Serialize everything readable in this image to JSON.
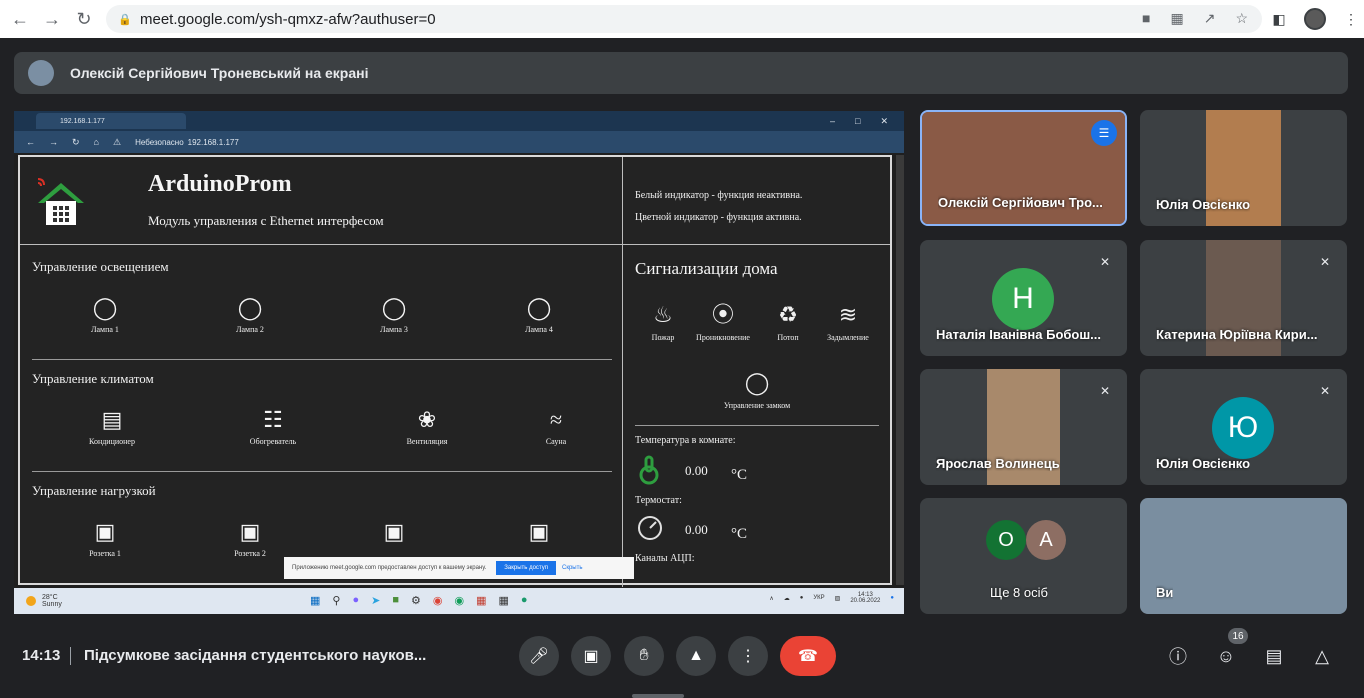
{
  "browser": {
    "url": "meet.google.com/ysh-qmxz-afw?authuser=0"
  },
  "banner": {
    "presenter_text": "Олексій Сергійович Троневський на екрані"
  },
  "shared": {
    "edge_tab_title": "192.168.1.177",
    "insecure_label": "Небезопасно",
    "address": "192.168.1.177",
    "brand": "ArduinoProm",
    "subtitle": "Модуль управления с Ethernet интерфесом",
    "legend_white": "Белый индикатор - функция неактивна.",
    "legend_color": "Цветной индикатор - функция активна.",
    "lighting_title": "Управление освещением",
    "lamps": [
      "Лампа 1",
      "Лампа 2",
      "Лампа 3",
      "Лампа 4"
    ],
    "climate_title": "Управление климатом",
    "climate": [
      "Кондиционер",
      "Обогреватель",
      "Вентиляция",
      "Сауна"
    ],
    "load_title": "Управление нагрузкой",
    "sockets": [
      "Розетка 1",
      "Розетка 2"
    ],
    "alarm_title": "Сигнализации дома",
    "alarms": [
      "Пожар",
      "Проникновение",
      "Потоп",
      "Задымление"
    ],
    "lock_label": "Управление замком",
    "temp_label": "Температура в комнате:",
    "temp_value": "0.00",
    "temp_unit": "°C",
    "thermostat_label": "Термостат:",
    "thermostat_value": "0.00",
    "thermostat_unit": "°C",
    "adc_label": "Каналы АЦП:",
    "share_note": "Приложению meet.google.com предоставлен доступ к вашему экрану.",
    "stop_sharing": "Закрыть доступ",
    "hide": "Скрыть",
    "weather_temp": "28°C",
    "weather_desc": "Sunny",
    "lang": "УКР",
    "tb_time": "14:13",
    "tb_date": "20.06.2022"
  },
  "participants": [
    {
      "name": "Олексій Сергійович Тро...",
      "speaking": true
    },
    {
      "name": "Юлія Овсієнко"
    },
    {
      "name": "Наталія Іванівна Бобош...",
      "letter": "Н",
      "color": "#34a853"
    },
    {
      "name": "Катерина Юріївна Кири..."
    },
    {
      "name": "Ярослав Волинець"
    },
    {
      "name": "Юлія Овсієнко",
      "letter": "Ю",
      "color": "#0097a7"
    },
    {
      "name": "Ще 8 осіб",
      "letters": [
        "О",
        "А"
      ]
    },
    {
      "name": "Ви"
    }
  ],
  "bottom": {
    "time": "14:13",
    "title": "Підсумкове засідання студентського науков...",
    "participants_count": "16"
  }
}
